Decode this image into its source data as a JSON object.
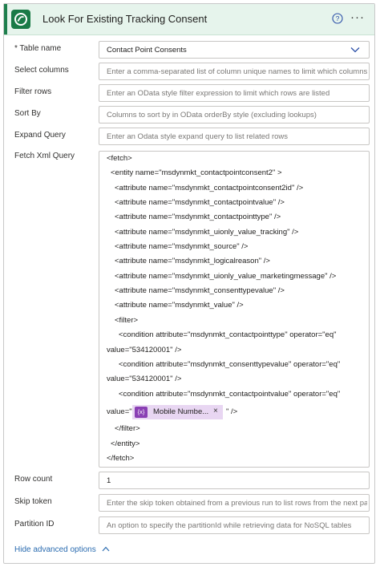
{
  "header": {
    "title": "Look For Existing Tracking Consent",
    "help_icon": "help-circle-icon",
    "more_icon": "more-options-icon",
    "more_glyph": "···",
    "accent": "#1e7f4d"
  },
  "fields": {
    "table_name": {
      "label": "* Table name",
      "value": "Contact Point Consents"
    },
    "select_columns": {
      "label": "Select columns",
      "placeholder": "Enter a comma-separated list of column unique names to limit which columns"
    },
    "filter_rows": {
      "label": "Filter rows",
      "placeholder": "Enter an OData style filter expression to limit which rows are listed"
    },
    "sort_by": {
      "label": "Sort By",
      "placeholder": "Columns to sort by in OData orderBy style (excluding lookups)"
    },
    "expand_query": {
      "label": "Expand Query",
      "placeholder": "Enter an Odata style expand query to list related rows"
    },
    "fetch_xml": {
      "label": "Fetch Xml Query",
      "lines": [
        "<fetch>",
        "<entity name=\"msdynmkt_contactpointconsent2\" >",
        "<attribute name=\"msdynmkt_contactpointconsent2id\" />",
        "<attribute name=\"msdynmkt_contactpointvalue\" />",
        "<attribute name=\"msdynmkt_contactpointtype\" />",
        "<attribute name=\"msdynmkt_uionly_value_tracking\" />",
        "<attribute name=\"msdynmkt_source\" />",
        "<attribute name=\"msdynmkt_logicalreason\" />",
        "<attribute name=\"msdynmkt_uionly_value_marketingmessage\" />",
        "<attribute name=\"msdynmkt_consenttypevalue\" />",
        "<attribute name=\"msdynmkt_value\" />",
        "<filter>",
        "<condition attribute=\"msdynmkt_contactpointtype\" operator=\"eq\"",
        "value=\"534120001\" />",
        "<condition attribute=\"msdynmkt_consenttypevalue\" operator=\"eq\"",
        "value=\"534120001\" />",
        "<condition attribute=\"msdynmkt_contactpointvalue\" operator=\"eq\"",
        "value=\"",
        "\" />",
        "</filter>",
        "</entity>",
        "</fetch>"
      ],
      "token": {
        "icon_label": "{x}",
        "label": "Mobile Numbe...",
        "remove": "×"
      }
    },
    "row_count": {
      "label": "Row count",
      "value": "1"
    },
    "skip_token": {
      "label": "Skip token",
      "placeholder": "Enter the skip token obtained from a previous run to list rows from the next pa"
    },
    "partition_id": {
      "label": "Partition ID",
      "placeholder": "An option to specify the partitionId while retrieving data for NoSQL tables"
    }
  },
  "footer": {
    "advanced_label": "Hide advanced options",
    "advanced_icon": "chevron-up-icon"
  }
}
